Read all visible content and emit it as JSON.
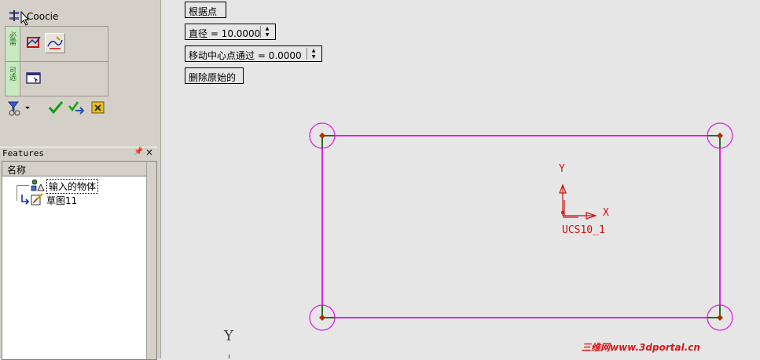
{
  "left_panel": {
    "title": "Coocie",
    "group_tab_1": "必需",
    "group_tab_2": "可选"
  },
  "features": {
    "header": "Features",
    "pin": "ㅁ",
    "close": "×",
    "column_header": "名称",
    "items": [
      {
        "label": "输入的物体"
      },
      {
        "label": "草图11"
      }
    ]
  },
  "options": {
    "pick_points_label": "根据点",
    "diameter_label": "直径 = 10.0000",
    "move_center_label": "移动中心点通过 =  0.0000",
    "delete_original_label": "删除原始的"
  },
  "viewport": {
    "ucs_name": "UCS10_1",
    "axis_x": "X",
    "axis_y": "Y",
    "world_axis_y": "Y",
    "watermark": "三维网www.3dportal.cn"
  },
  "colors": {
    "sketch_line": "#e020e0",
    "corner_marker": "#b03000",
    "ucs": "#d01010",
    "corner_segment": "#207020"
  }
}
